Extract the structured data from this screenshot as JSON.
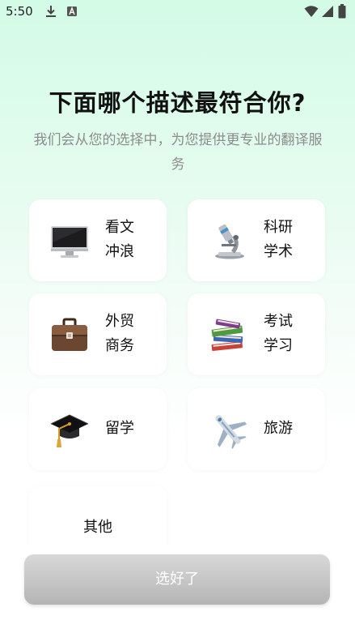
{
  "status_bar": {
    "time": "5:50"
  },
  "header": {
    "title": "下面哪个描述最符合你?",
    "subtitle": "我们会从您的选择中，为您提供更专业的翻译服务"
  },
  "options": [
    {
      "label_line1": "看文",
      "label_line2": "冲浪",
      "icon": "computer-monitor-icon"
    },
    {
      "label_line1": "科研",
      "label_line2": "学术",
      "icon": "microscope-icon"
    },
    {
      "label_line1": "外贸",
      "label_line2": "商务",
      "icon": "briefcase-icon"
    },
    {
      "label_line1": "考试",
      "label_line2": "学习",
      "icon": "books-icon"
    },
    {
      "label_line1": "留学",
      "icon": "graduation-cap-icon"
    },
    {
      "label_line1": "旅游",
      "icon": "airplane-icon"
    },
    {
      "label_line1": "其他"
    }
  ],
  "footer": {
    "confirm_label": "选好了"
  },
  "colors": {
    "background_top": "#d3fbe6",
    "card_background": "#ffffff",
    "button_gray": "#c5c5c5"
  }
}
